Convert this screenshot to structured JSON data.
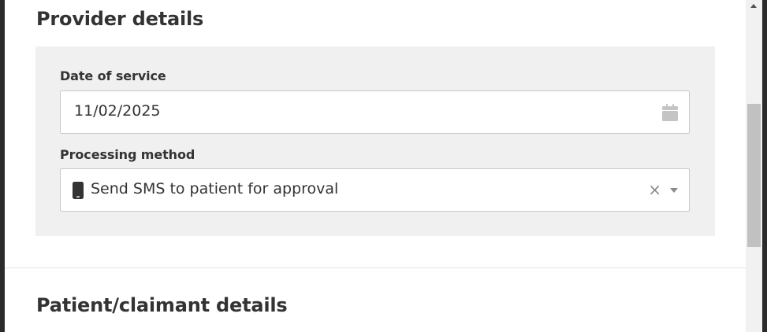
{
  "provider_section": {
    "title": "Provider details",
    "date_of_service": {
      "label": "Date of service",
      "value": "11/02/2025",
      "icon": "calendar-icon"
    },
    "processing_method": {
      "label": "Processing method",
      "selected": "Send SMS to patient for approval",
      "icon": "mobile-phone-icon",
      "clear_glyph": "×"
    }
  },
  "patient_section": {
    "title": "Patient/claimant details"
  },
  "colors": {
    "panel_bg": "#f0f0f0",
    "text": "#333333",
    "icon_muted": "#8a8a8a",
    "border": "#c9c9c9"
  }
}
